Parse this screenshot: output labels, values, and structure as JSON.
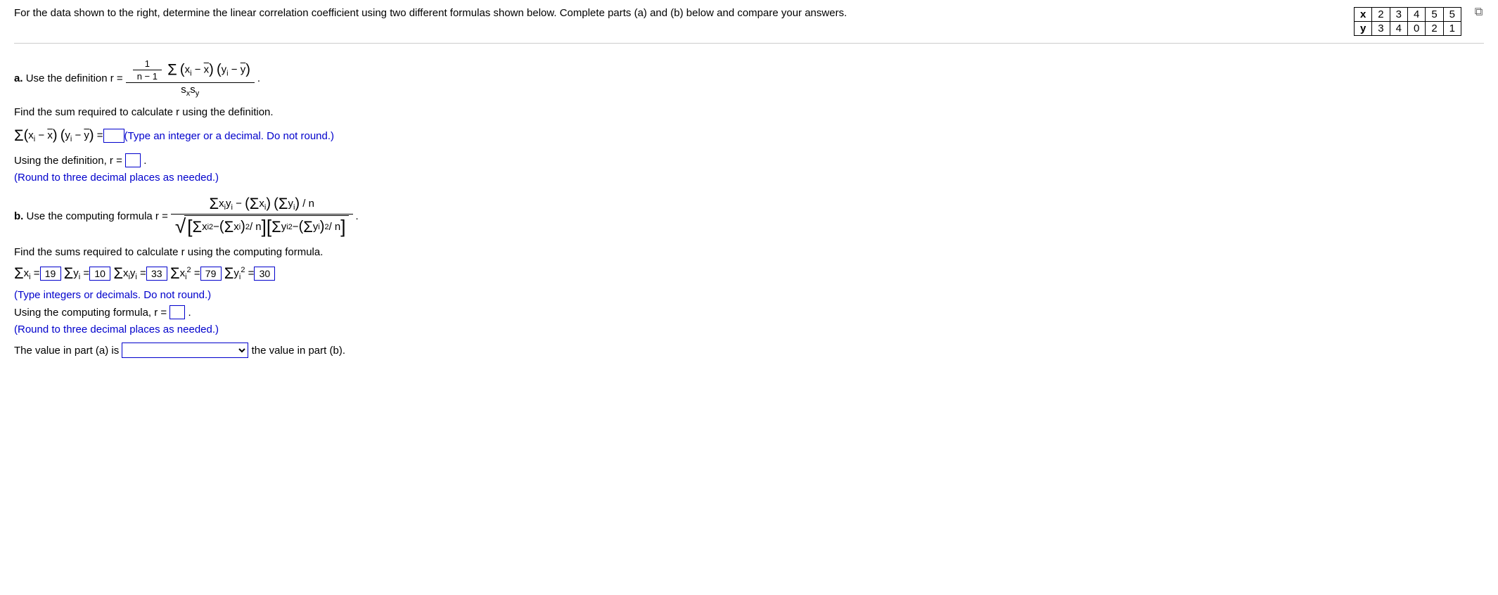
{
  "intro": "For the data shown to the right, determine the linear correlation coefficient using two different formulas shown below. Complete parts (a) and (b) below and compare your answers.",
  "table": {
    "x_label": "x",
    "y_label": "y",
    "x": [
      "2",
      "3",
      "4",
      "5",
      "5"
    ],
    "y": [
      "3",
      "4",
      "0",
      "2",
      "1"
    ]
  },
  "partA": {
    "label": "a.",
    "lead": "Use the definition r =",
    "after": ".",
    "find_sum_text": "Find the sum required to calculate r using the definition.",
    "sum_hint": "(Type an integer or a decimal. Do not round.)",
    "using_def_text": "Using the definition, r =",
    "round_hint": "(Round to three decimal places as needed.)",
    "sum_value": "",
    "r_value": ""
  },
  "partB": {
    "label": "b.",
    "lead": "Use the computing formula r =",
    "after": ".",
    "find_sums_text": "Find the sums required to calculate r using the computing formula.",
    "sums": {
      "sx_label": "Σx",
      "sx_value": "19",
      "sy_label": "Σy",
      "sy_value": "10",
      "sxy_label": "Σxy",
      "sxy_value": "33",
      "sx2_label": "Σx²",
      "sx2_value": "79",
      "sy2_label": "Σy²",
      "sy2_value": "30"
    },
    "type_hint": "(Type integers or decimals. Do not round.)",
    "using_comp_text": "Using the computing formula, r =",
    "round_hint": "(Round to three decimal places as needed.)",
    "r_value": ""
  },
  "compare": {
    "before": "The value in part (a) is",
    "after": "the value in part (b)."
  }
}
